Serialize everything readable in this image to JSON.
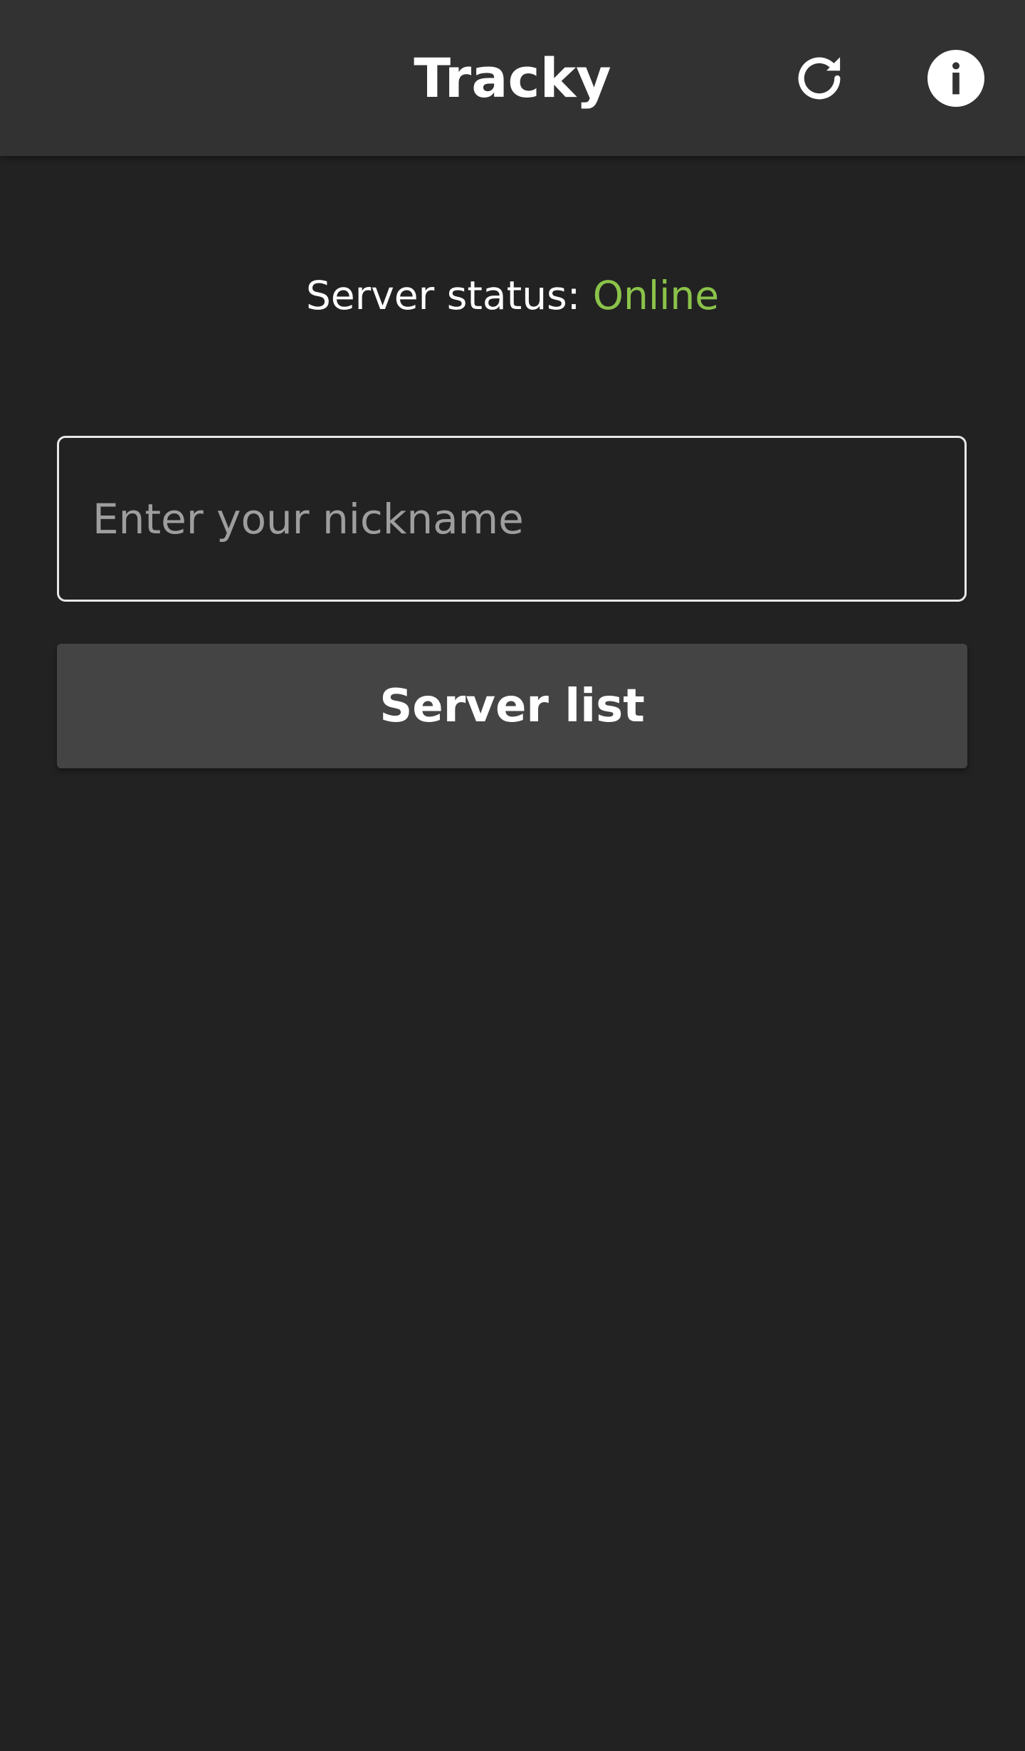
{
  "app_bar": {
    "title": "Tracky",
    "refresh_icon": "refresh-icon",
    "info_icon": "info-icon"
  },
  "status": {
    "label": "Server status: ",
    "value": "Online",
    "value_color": "#8bc34a"
  },
  "nickname": {
    "value": "",
    "placeholder": "Enter your nickname"
  },
  "server_list_button": {
    "label": "Server list"
  },
  "colors": {
    "background": "#222222",
    "app_bar": "#323232",
    "button": "#444444"
  }
}
